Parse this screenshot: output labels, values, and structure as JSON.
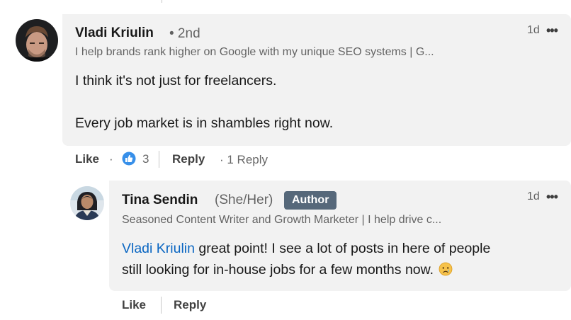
{
  "comment": {
    "author_name": "Vladi Kriulin",
    "connection_degree": "• 2nd",
    "headline": "I help brands rank higher on Google with my unique SEO systems | G...",
    "time": "1d",
    "more_label": "•••",
    "text_line1": "I think it's not just for freelancers.",
    "text_line2": "Every job market is in shambles right now.",
    "actions": {
      "like_label": "Like",
      "dot": "·",
      "reaction_count": "3",
      "reply_label": "Reply",
      "replies_count": "· 1 Reply"
    }
  },
  "reply": {
    "author_name": "Tina Sendin",
    "pronouns": "(She/Her)",
    "badge": "Author",
    "headline": "Seasoned Content Writer and Growth Marketer | I help drive c...",
    "time": "1d",
    "more_label": "•••",
    "mention": "Vladi Kriulin",
    "text_line1_rest": " great point! I see a lot of posts in here of people",
    "text_line2": "still looking for in-house jobs for a few months now.",
    "emoji": "😢",
    "actions": {
      "like_label": "Like",
      "reply_label": "Reply"
    }
  },
  "colors": {
    "bubble_bg": "#f2f2f2",
    "link": "#0a66c2",
    "badge_bg": "#56687a",
    "like_icon": "#378fe9"
  },
  "icons": [
    "avatar-vladi",
    "avatar-tina",
    "more-icon",
    "like-reaction-icon",
    "crying-emoji"
  ]
}
